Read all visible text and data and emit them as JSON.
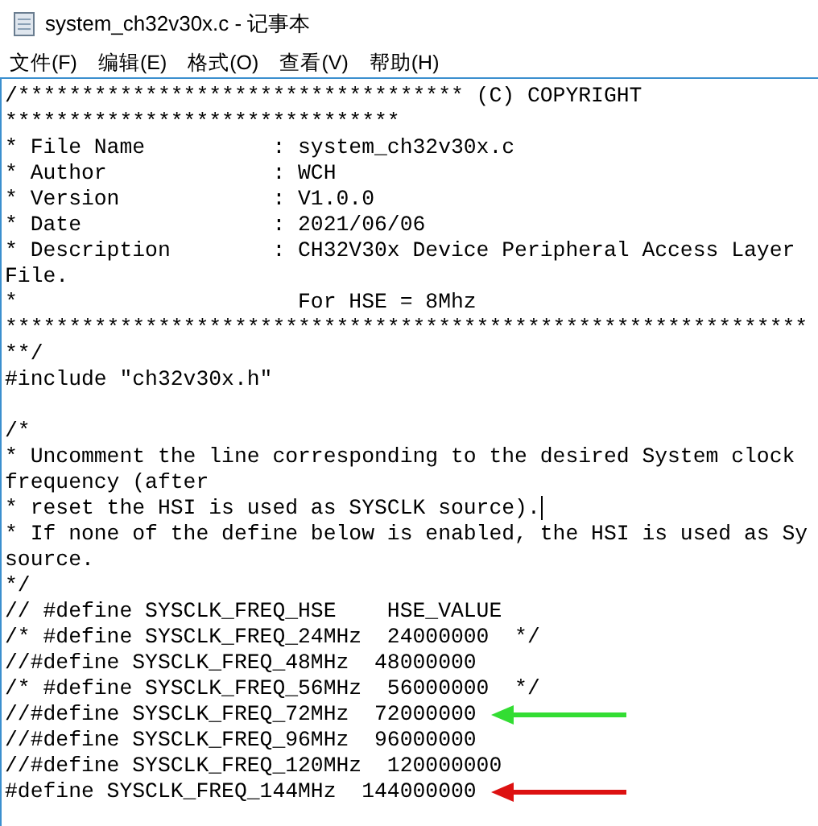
{
  "window": {
    "title": "system_ch32v30x.c - 记事本"
  },
  "menu": [
    {
      "label": "文件(F)"
    },
    {
      "label": "编辑(E)"
    },
    {
      "label": "格式(O)"
    },
    {
      "label": "查看(V)"
    },
    {
      "label": "帮助(H)"
    }
  ],
  "lines": [
    {
      "text": "/*********************************** (C) COPYRIGHT",
      "cursor": false
    },
    {
      "text": "*******************************",
      "cursor": false
    },
    {
      "text": "* File Name          : system_ch32v30x.c",
      "cursor": false
    },
    {
      "text": "* Author             : WCH",
      "cursor": false
    },
    {
      "text": "* Version            : V1.0.0",
      "cursor": false
    },
    {
      "text": "* Date               : 2021/06/06",
      "cursor": false
    },
    {
      "text": "* Description        : CH32V30x Device Peripheral Access Layer",
      "cursor": false
    },
    {
      "text": "File.",
      "cursor": false
    },
    {
      "text": "*                      For HSE = 8Mhz",
      "cursor": false
    },
    {
      "text": "***************************************************************",
      "cursor": false
    },
    {
      "text": "**/",
      "cursor": false
    },
    {
      "text": "#include \"ch32v30x.h\"",
      "cursor": false
    },
    {
      "cursor": false
    },
    {
      "text": "/*",
      "cursor": false
    },
    {
      "text": "* Uncomment the line corresponding to the desired System clock",
      "cursor": false
    },
    {
      "text": "frequency (after",
      "cursor": false
    },
    {
      "text": "* reset the HSI is used as SYSCLK source).",
      "cursor": true
    },
    {
      "text": "* If none of the define below is enabled, the HSI is used as Sy",
      "cursor": false
    },
    {
      "text": "source.",
      "cursor": false
    },
    {
      "text": "*/",
      "cursor": false
    },
    {
      "text": "// #define SYSCLK_FREQ_HSE    HSE_VALUE",
      "cursor": false
    },
    {
      "text": "/* #define SYSCLK_FREQ_24MHz  24000000  */",
      "cursor": false
    },
    {
      "text": "//#define SYSCLK_FREQ_48MHz  48000000",
      "cursor": false
    },
    {
      "text": "/* #define SYSCLK_FREQ_56MHz  56000000  */",
      "cursor": false
    },
    {
      "text": "//#define SYSCLK_FREQ_72MHz  72000000",
      "cursor": false,
      "arrow": {
        "color": "#33dd33"
      }
    },
    {
      "text": "//#define SYSCLK_FREQ_96MHz  96000000",
      "cursor": false
    },
    {
      "text": "//#define SYSCLK_FREQ_120MHz  120000000",
      "cursor": false
    },
    {
      "text": "#define SYSCLK_FREQ_144MHz  144000000",
      "cursor": false,
      "arrow": {
        "color": "#dd1111"
      }
    }
  ]
}
